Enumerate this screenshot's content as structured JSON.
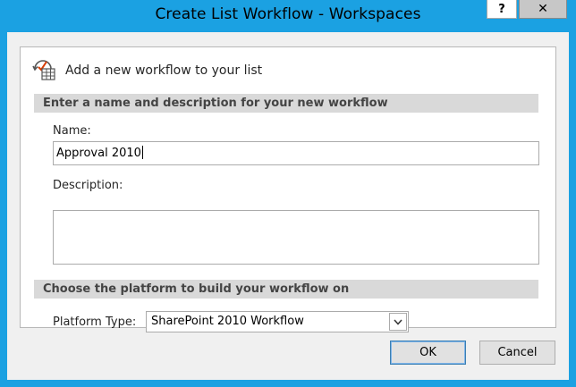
{
  "window": {
    "title": "Create List Workflow - Workspaces",
    "help_label": "?",
    "close_label": "✕"
  },
  "header": {
    "text": "Add a new workflow to your list",
    "icon": "workflow-list-icon"
  },
  "section_name": {
    "heading": "Enter a name and description for your new workflow",
    "name_label": "Name:",
    "name_value": "Approval 2010",
    "description_label": "Description:",
    "description_value": ""
  },
  "section_platform": {
    "heading": "Choose the platform to build your workflow on",
    "platform_label": "Platform Type:",
    "platform_value": "SharePoint 2010 Workflow"
  },
  "buttons": {
    "ok": "OK",
    "cancel": "Cancel"
  },
  "colors": {
    "titlebar": "#1ba1e2",
    "section_bar": "#d9d9d9",
    "dialog_bg": "#f0f0f0"
  }
}
